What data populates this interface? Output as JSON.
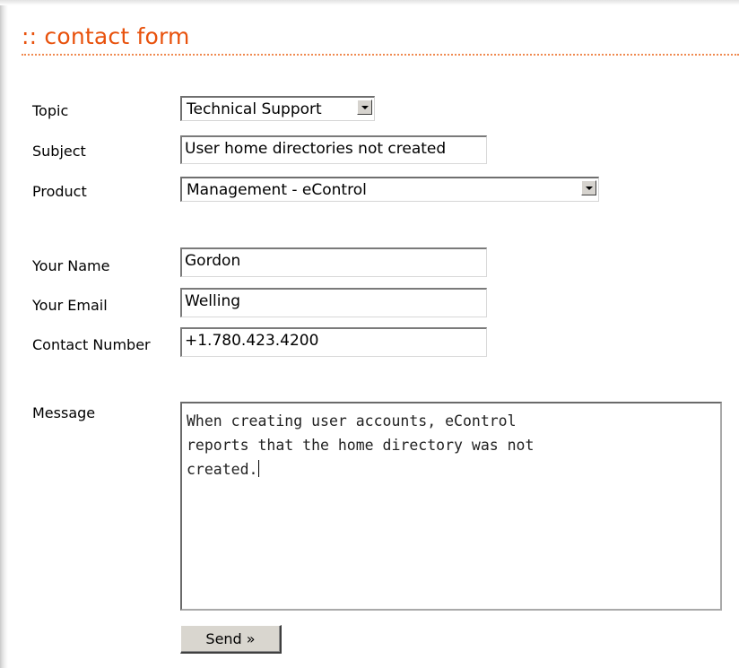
{
  "form": {
    "title": ":: contact form",
    "topic": {
      "label": "Topic",
      "selected": "Technical Support"
    },
    "subject": {
      "label": "Subject",
      "value": "User home directories not created"
    },
    "product": {
      "label": "Product",
      "selected": "Management - eControl"
    },
    "name": {
      "label": "Your Name",
      "value": "Gordon"
    },
    "email": {
      "label": "Your Email",
      "value": "Welling"
    },
    "phone": {
      "label": "Contact Number",
      "value": "+1.780.423.4200"
    },
    "message": {
      "label": "Message",
      "value": "When creating user accounts, eControl\nreports that the home directory was not\ncreated."
    },
    "send_label": "Send »"
  },
  "colors": {
    "accent": "#e8520d",
    "button": "#d9d6cf"
  }
}
